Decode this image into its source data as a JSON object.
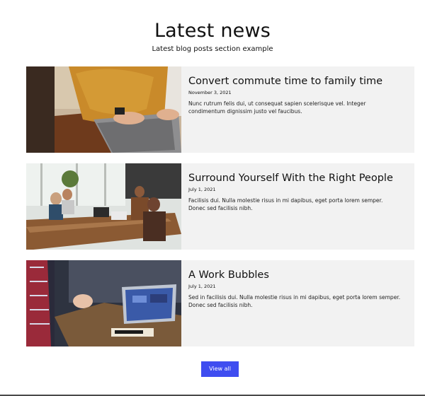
{
  "section": {
    "title": "Latest news",
    "subtitle": "Latest blog posts section example"
  },
  "posts": [
    {
      "title": "Convert commute time to family time",
      "date": "November 3, 2021",
      "excerpt": "Nunc rutrum felis dui, ut consequat sapien scelerisque vel. Integer condimentum dignissim justo vel faucibus.",
      "image": "person-typing-on-laptop-photo"
    },
    {
      "title": "Surround Yourself With the Right People",
      "date": "July 1, 2021",
      "excerpt": "Facilisis dui. Nulla molestie risus in mi dapibus, eget porta lorem semper. Donec sed facilisis nibh.",
      "image": "office-meeting-photo"
    },
    {
      "title": "A Work Bubbles",
      "date": "July 1, 2021",
      "excerpt": "Sed in facilisis dui. Nulla molestie risus in mi dapibus, eget porta lorem semper. Donec sed facilisis nibh.",
      "image": "laptop-discussion-photo"
    }
  ],
  "actions": {
    "view_all_label": "View all"
  },
  "colors": {
    "accent": "#3f4df0",
    "card_background": "#f2f2f2"
  }
}
